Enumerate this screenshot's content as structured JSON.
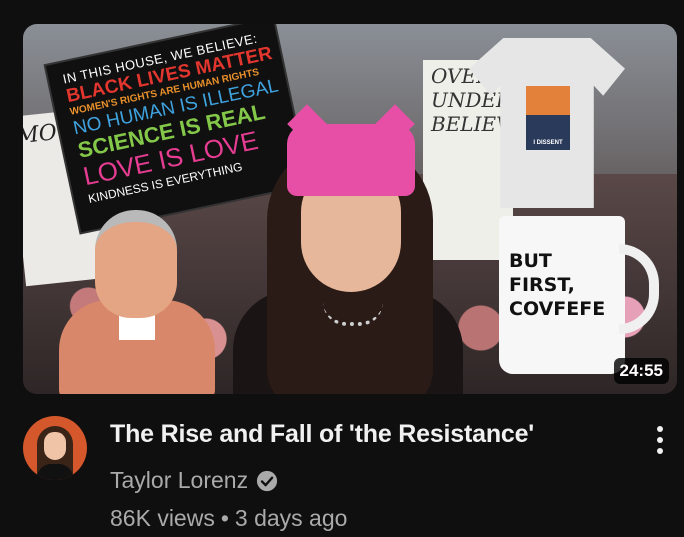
{
  "video": {
    "title": "The Rise and Fall of 'the Resistance'",
    "duration": "24:55",
    "channel": "Taylor Lorenz",
    "views": "86K views",
    "separator": "•",
    "age": "3 days ago"
  },
  "thumbnail_text": {
    "belief_sign": [
      "IN THIS HOUSE, WE BELIEVE:",
      "BLACK LIVES MATTER",
      "WOMEN'S RIGHTS ARE HUMAN RIGHTS",
      "NO HUMAN IS ILLEGAL",
      "SCIENCE IS REAL",
      "LOVE IS LOVE",
      "KINDNESS IS EVERYTHING"
    ],
    "mug": [
      "BUT",
      "FIRST,",
      "COVFEFE"
    ],
    "tshirt": "I DISSENT",
    "left_sign": "MOTHERS",
    "mid_sign": "OVER UNDERWEAR BELIEV"
  },
  "icons": {
    "verified": "verified-check-icon",
    "more": "more-vertical-icon"
  },
  "colors": {
    "background": "#0f0f0f",
    "title": "#f1f1f1",
    "secondary": "#aaaaaa",
    "hat_pink": "#e74fa7"
  }
}
